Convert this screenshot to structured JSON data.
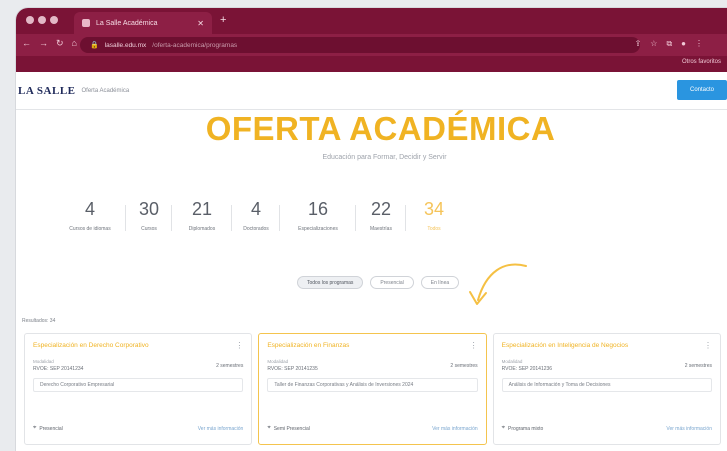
{
  "browser": {
    "tab_title": "La Salle Académica",
    "url_host": "lasalle.edu.mx",
    "url_path": "/oferta-academica/programas",
    "bookmark_right": "Otros favoritos"
  },
  "site": {
    "logo": "LA SALLE",
    "logo_sub": "Oferta Académica",
    "header_button": "Contacto"
  },
  "hero": {
    "title": "OFERTA ACADÉMICA",
    "subtitle": "Educación para Formar, Decidir y Servir"
  },
  "stats": [
    {
      "value": "4",
      "label": "Cursos de idiomas"
    },
    {
      "value": "30",
      "label": "Cursos"
    },
    {
      "value": "21",
      "label": "Diplomados"
    },
    {
      "value": "4",
      "label": "Doctorados"
    },
    {
      "value": "16",
      "label": "Especializaciones"
    },
    {
      "value": "22",
      "label": "Maestrías"
    },
    {
      "value": "34",
      "label": "Todos",
      "active": true
    }
  ],
  "filters": [
    {
      "label": "Todos los programas",
      "active": true
    },
    {
      "label": "Presencial"
    },
    {
      "label": "En línea"
    }
  ],
  "results_label": "Resultados: 34",
  "cards": [
    {
      "title": "Especialización en Derecho Corporativo",
      "meta_label": "Modalidad",
      "meta_value": "RVOE: SEP 20141234",
      "meta_right": "2 semestres",
      "desc": "Derecho Corporativo Empresarial",
      "place": "Presencial",
      "more": "Ver más información",
      "highlight": false
    },
    {
      "title": "Especialización en Finanzas",
      "meta_label": "Modalidad",
      "meta_value": "RVOE: SEP 20141235",
      "meta_right": "2 semestres",
      "desc": "Taller de Finanzas Corporativas y Análisis de Inversiones 2024",
      "place": "Semi Presencial",
      "more": "Ver más información",
      "highlight": true
    },
    {
      "title": "Especialización en Inteligencia de Negocios",
      "meta_label": "Modalidad",
      "meta_value": "RVOE: SEP 20141236",
      "meta_right": "2 semestres",
      "desc": "Análisis de Información y Toma de Decisiones",
      "place": "Programa mixto",
      "more": "Ver más información",
      "highlight": false
    }
  ],
  "colors": {
    "brand": "#7a1336",
    "accent": "#f0b323",
    "link": "#2a95e0"
  }
}
